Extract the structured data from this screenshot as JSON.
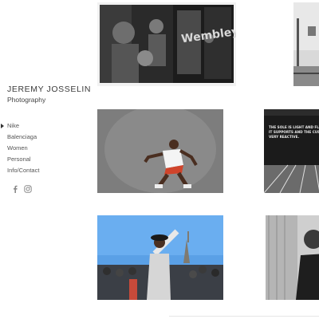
{
  "brand": {
    "name": "JEREMY JOSSELIN",
    "subtitle": "Photography"
  },
  "nav": {
    "items": [
      {
        "label": "Nike",
        "active": true
      },
      {
        "label": "Balenciaga",
        "active": false
      },
      {
        "label": "Women",
        "active": false
      },
      {
        "label": "Personal",
        "active": false
      },
      {
        "label": "Info/Contact",
        "active": false
      }
    ]
  },
  "social": [
    {
      "icon": "facebook-icon"
    },
    {
      "icon": "instagram-icon"
    }
  ],
  "photos": {
    "storefront": {
      "text": "Wembley"
    },
    "poster": {
      "text": "THE SOLE IS LIGHT AND FLEXIBLE\nIT SUPPORTS AND THE CUSHIONING\nVERY REACTIVE."
    }
  },
  "colors": {
    "nav_text": "#555555",
    "brand_text": "#3a3a3a",
    "icon_gray": "#8a8a8a"
  }
}
